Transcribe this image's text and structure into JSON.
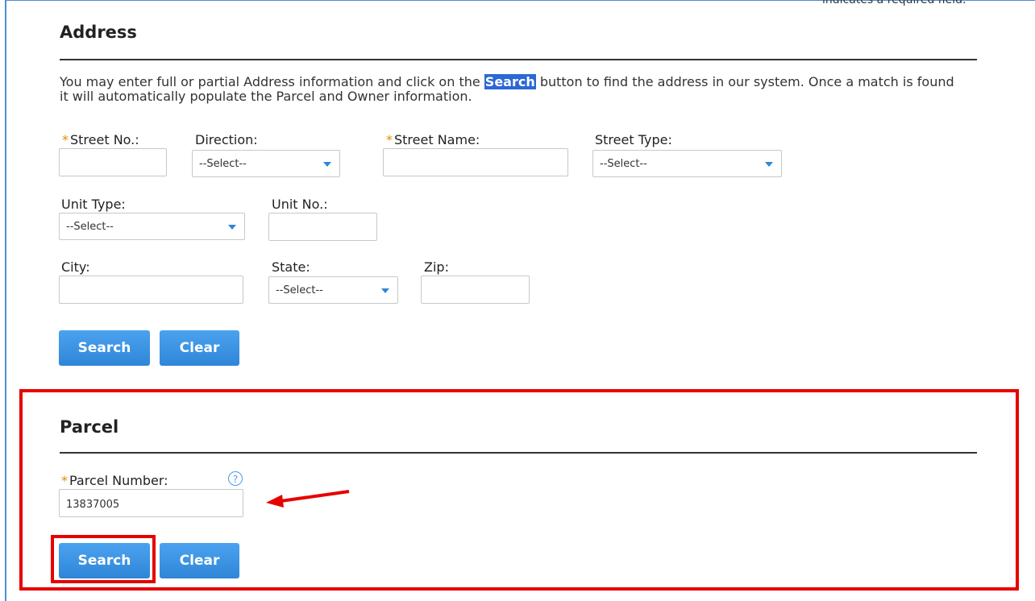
{
  "required_note": "indicates a required field.",
  "address": {
    "title": "Address",
    "description_before": "You may enter full or partial Address information and click on the ",
    "description_highlight": "Search",
    "description_after": " button to find the address in our system. Once a match is found it will automatically populate the Parcel and Owner information.",
    "street_no_label": "Street No.:",
    "direction_label": "Direction:",
    "direction_value": "--Select--",
    "street_name_label": "Street Name:",
    "street_type_label": "Street Type:",
    "street_type_value": "--Select--",
    "unit_type_label": "Unit Type:",
    "unit_type_value": "--Select--",
    "unit_no_label": "Unit No.:",
    "city_label": "City:",
    "state_label": "State:",
    "state_value": "--Select--",
    "zip_label": "Zip:",
    "search_button": "Search",
    "clear_button": "Clear"
  },
  "parcel": {
    "title": "Parcel",
    "parcel_number_label": "Parcel Number:",
    "parcel_number_value": "13837005",
    "help_icon": "?",
    "search_button": "Search",
    "clear_button": "Clear"
  },
  "required_marker": "*",
  "colors": {
    "button": "#3d95e6",
    "highlight": "#2b67d6",
    "annotation": "#e60000",
    "required": "#e28a00"
  }
}
